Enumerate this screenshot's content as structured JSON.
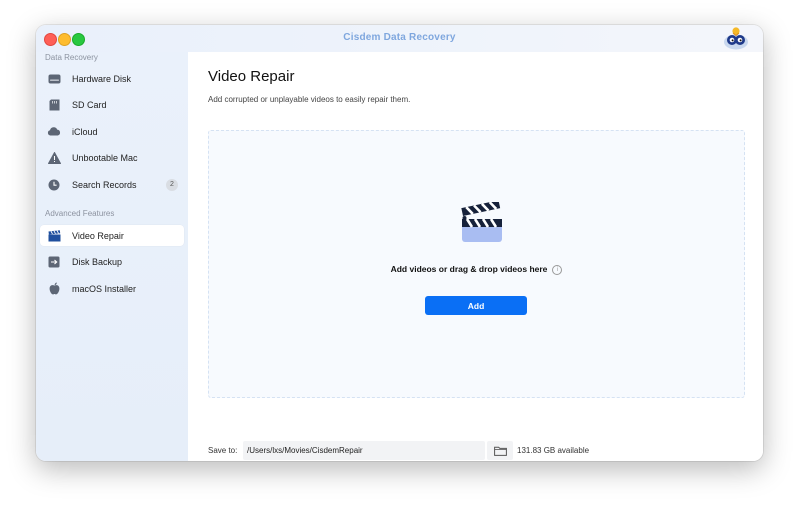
{
  "window": {
    "title": "Cisdem Data Recovery"
  },
  "sidebar": {
    "section_data_recovery": "Data Recovery",
    "section_advanced": "Advanced Features",
    "items": [
      {
        "label": "Hardware Disk",
        "icon": "hard-disk-icon"
      },
      {
        "label": "SD Card",
        "icon": "sd-card-icon"
      },
      {
        "label": "iCloud",
        "icon": "cloud-icon"
      },
      {
        "label": "Unbootable Mac",
        "icon": "warning-icon"
      },
      {
        "label": "Search Records",
        "icon": "clock-icon",
        "badge": "2"
      },
      {
        "label": "Video Repair",
        "icon": "clapperboard-icon",
        "active": true
      },
      {
        "label": "Disk Backup",
        "icon": "disk-backup-icon"
      },
      {
        "label": "macOS Installer",
        "icon": "apple-icon"
      }
    ]
  },
  "main": {
    "title": "Video Repair",
    "subtitle": "Add corrupted or unplayable videos to easily repair them.",
    "drop_text": "Add videos or drag & drop videos here",
    "info_glyph": "i",
    "add_label": "Add",
    "save_label": "Save to:",
    "save_path": "/Users/lxs/Movies/CisdemRepair",
    "available": "131.83 GB available"
  },
  "colors": {
    "accent": "#0a6ff5",
    "title": "#7fa7de",
    "sidebar_bg": "#e8f0fa"
  }
}
